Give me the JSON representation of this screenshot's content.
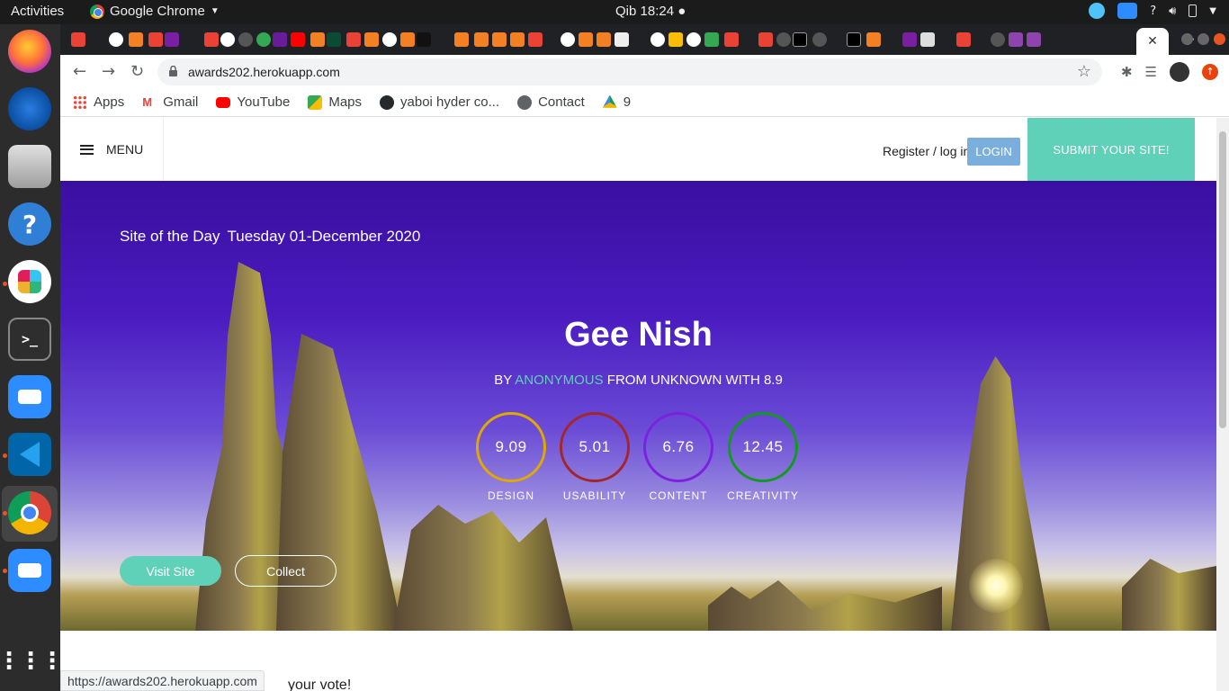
{
  "gnome": {
    "activities": "Activities",
    "app_name": "Google Chrome",
    "clock": "Qib 18:24 ●",
    "tray_question": "?"
  },
  "browser": {
    "url": "awards202.herokuapp.com",
    "status_url": "https://awards202.herokuapp.com",
    "bookmarks": [
      {
        "label": "Apps",
        "icon": "apps-grid-icon"
      },
      {
        "label": "Gmail",
        "icon": "gmail-icon"
      },
      {
        "label": "YouTube",
        "icon": "youtube-icon"
      },
      {
        "label": "Maps",
        "icon": "maps-icon"
      },
      {
        "label": "yaboi hyder co...",
        "icon": "github-icon"
      },
      {
        "label": "Contact",
        "icon": "globe-icon"
      },
      {
        "label": "9",
        "icon": "drive-icon"
      }
    ],
    "active_tab_close": "✕",
    "new_tab": "+"
  },
  "site": {
    "menu_label": "MENU",
    "register_label": "Register / log in",
    "login_label": "LOGIN",
    "submit_label": "SUBMIT YOUR SITE!",
    "sotd_label": "Site of the Day",
    "sotd_date": "Tuesday 01-December 2020",
    "title": "Gee Nish",
    "by": "BY",
    "author": "ANONYMOUS",
    "from_text": "FROM UNKNOWN WITH 8.9",
    "scores": [
      {
        "value": "9.09",
        "label": "DESIGN",
        "color": "#e0a800"
      },
      {
        "value": "5.01",
        "label": "USABILITY",
        "color": "#a3262c"
      },
      {
        "value": "6.76",
        "label": "CONTENT",
        "color": "#7b22e0"
      },
      {
        "value": "12.45",
        "label": "CREATIVITY",
        "color": "#139a1e"
      }
    ],
    "visit_label": "Visit Site",
    "collect_label": "Collect",
    "below_text": "your vote!"
  },
  "colors": {
    "accent": "#5ed1b8",
    "login": "#7aaedc"
  }
}
